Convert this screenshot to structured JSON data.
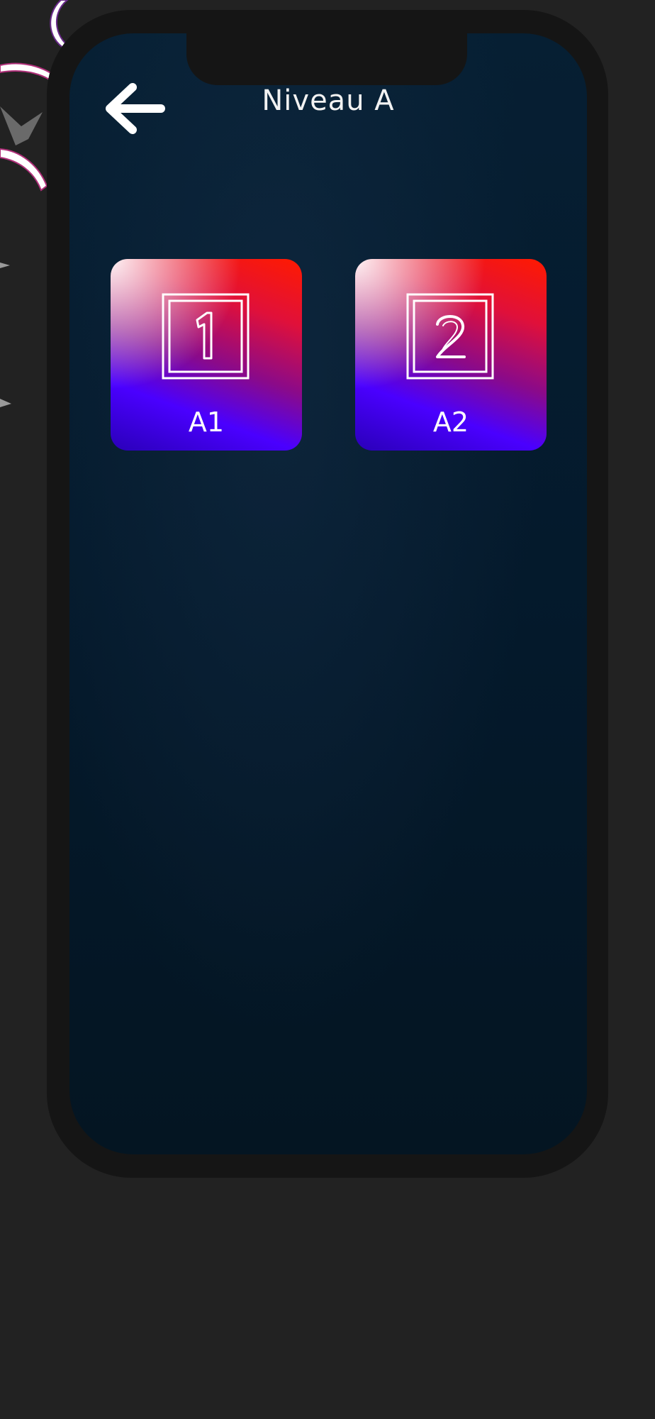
{
  "header": {
    "title": "Niveau A",
    "back_icon": "arrow-left-icon"
  },
  "levels": [
    {
      "label": "A1",
      "number": "1",
      "icon": "number-1-icon"
    },
    {
      "label": "A2",
      "number": "2",
      "icon": "number-2-icon"
    }
  ],
  "colors": {
    "background": "#222222",
    "phone_frame": "#151515",
    "screen": "#061f33",
    "tile_gradient_top": "#ff1a00",
    "tile_gradient_bottom": "#4a00ff",
    "text": "#ffffff"
  }
}
